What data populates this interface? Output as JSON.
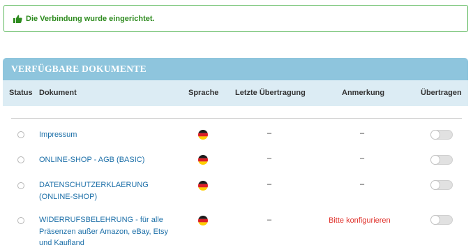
{
  "alert": {
    "message": "Die Verbindung wurde eingerichtet.",
    "icon": "thumbs-up-icon",
    "color": "#2e8b1f"
  },
  "panel": {
    "title": "VERFÜGBARE DOKUMENTE"
  },
  "columns": {
    "status": "Status",
    "document": "Dokument",
    "language": "Sprache",
    "last_transfer": "Letzte Übertragung",
    "remark": "Anmerkung",
    "transfer": "Übertragen"
  },
  "rows": [
    {
      "document": "Impressum",
      "language": "german-flag-icon",
      "last_transfer": "–",
      "remark": "–",
      "transfer_enabled": false
    },
    {
      "document": "ONLINE-SHOP - AGB (BASIC)",
      "language": "german-flag-icon",
      "last_transfer": "–",
      "remark": "–",
      "transfer_enabled": false
    },
    {
      "document": "DATENSCHUTZERKLAERUNG (ONLINE-SHOP)",
      "language": "german-flag-icon",
      "last_transfer": "–",
      "remark": "–",
      "transfer_enabled": false
    },
    {
      "document": "WIDERRUFSBELEHRUNG - für alle Präsenzen außer Amazon, eBay, Etsy und Kaufland",
      "language": "german-flag-icon",
      "last_transfer": "–",
      "remark": "Bitte konfigurieren",
      "transfer_enabled": false
    }
  ],
  "colors": {
    "panel_header": "#8ec5dd",
    "column_header": "#dcecf4",
    "link": "#1c6fa8",
    "warning": "#e0302a"
  }
}
